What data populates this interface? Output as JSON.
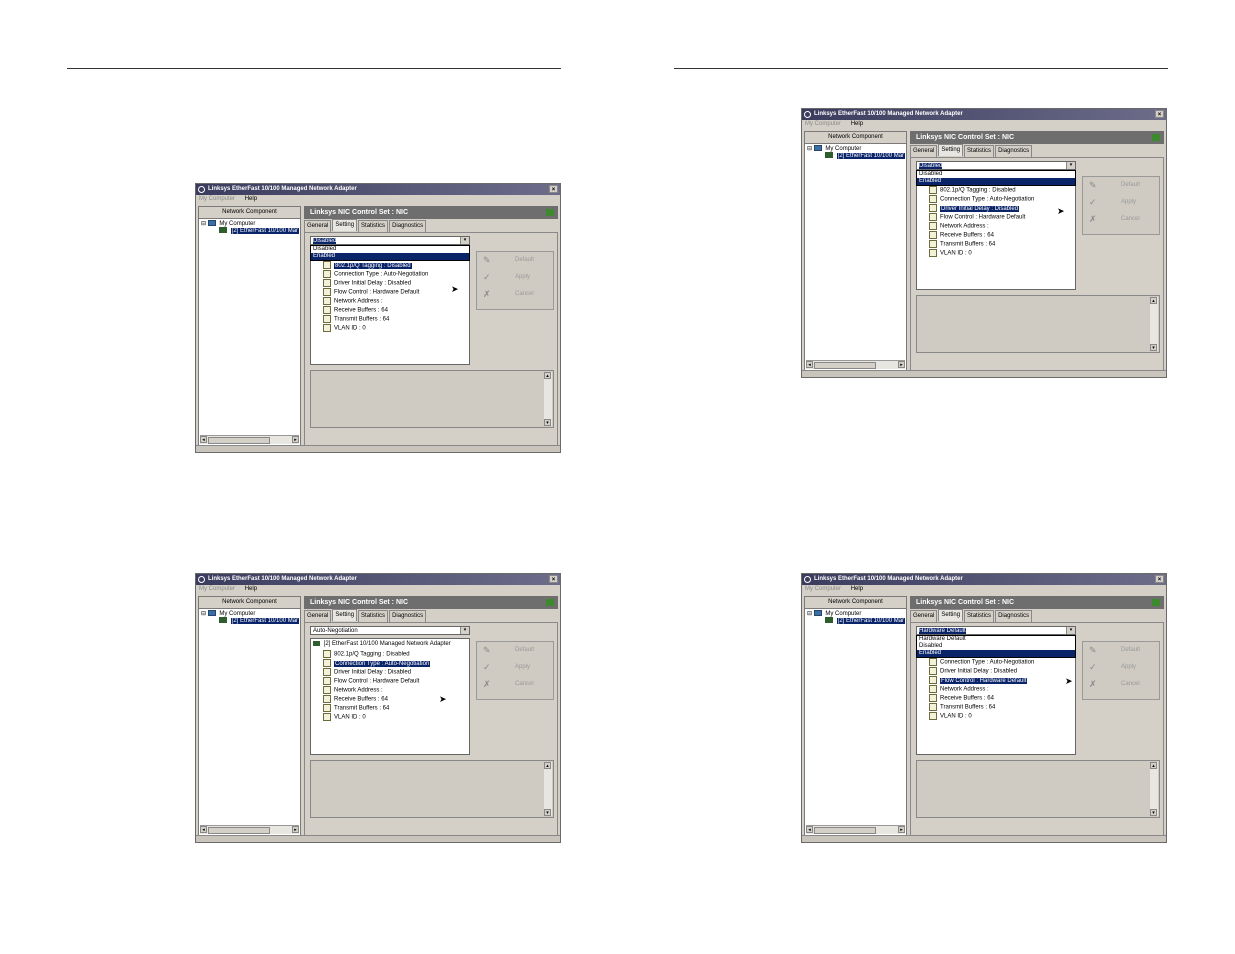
{
  "window": {
    "title": "Linksys EtherFast 10/100 Managed Network Adapter",
    "close_glyph": "×",
    "menu_computer": "My Computer",
    "menu_help": "Help"
  },
  "left": {
    "header": "Network Component",
    "tree_root": "My Computer",
    "tree_root_expander": "⊟",
    "tree_child": "[2] EtherFast 10/100 Mar"
  },
  "panel": {
    "title": "Linksys NIC Control Set : NIC",
    "tabs": [
      "General",
      "Setting",
      "Statistics",
      "Diagnostics"
    ]
  },
  "buttons": {
    "default_label": "Default",
    "apply_label": "Apply",
    "cancel_label": "Cancel",
    "default_icon": "wrench-icon",
    "apply_icon": "check-icon",
    "cancel_icon": "x-icon"
  },
  "settings_root": "[2] EtherFast 10/100 Managed Network Adapter",
  "screens": [
    {
      "combo_value": "Disabled",
      "dropdown_options": [
        "Disabled",
        "Enabled"
      ],
      "dropdown_highlight": 1,
      "show_root": false,
      "settings": [
        "802.1p/Q Tagging : Disabled",
        "Connection Type : Auto-Negotiation",
        "Driver Initial Delay : Disabled",
        "Flow Control : Hardware Default",
        "Network Address :",
        "Receive Buffers : 64",
        "Transmit Buffers : 64",
        "VLAN ID : 0"
      ],
      "highlight": 0
    },
    {
      "combo_value": "Disabled",
      "dropdown_options": [
        "Disabled",
        "Enabled"
      ],
      "dropdown_highlight": 1,
      "show_root": false,
      "settings": [
        "802.1p/Q Tagging : Disabled",
        "Connection Type : Auto-Negotiation",
        "Driver Initial Delay : Disabled",
        "Flow Control : Hardware Default",
        "Network Address :",
        "Receive Buffers : 64",
        "Transmit Buffers : 64",
        "VLAN ID : 0"
      ],
      "highlight": 2
    },
    {
      "combo_value": "Auto-Negotiation",
      "dropdown_options": [],
      "dropdown_highlight": -1,
      "show_root": true,
      "settings": [
        "802.1p/Q Tagging : Disabled",
        "Connection Type : Auto-Negotiation",
        "Driver Initial Delay : Disabled",
        "Flow Control : Hardware Default",
        "Network Address :",
        "Receive Buffers : 64",
        "Transmit Buffers : 64",
        "VLAN ID : 0"
      ],
      "highlight": 1
    },
    {
      "combo_value": "Hardware Default",
      "dropdown_options": [
        "Hardware Default",
        "Disabled",
        "Enabled"
      ],
      "dropdown_highlight": 2,
      "show_root": false,
      "settings": [
        "Connection Type : Auto-Negotiation",
        "Driver Initial Delay : Disabled",
        "Flow Control : Hardware Default",
        "Network Address :",
        "Receive Buffers : 64",
        "Transmit Buffers : 64",
        "VLAN ID : 0"
      ],
      "highlight": 2
    }
  ]
}
